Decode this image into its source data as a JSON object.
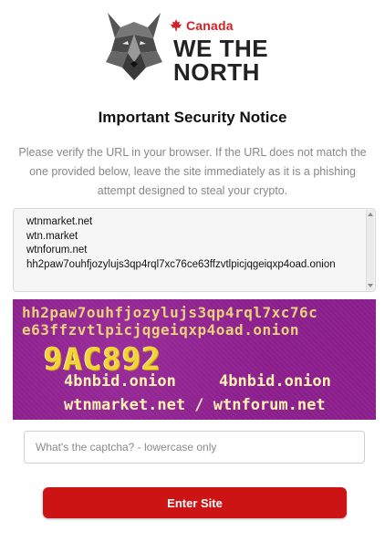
{
  "brand": {
    "country": "Canada",
    "line1": "WE THE",
    "line2": "NORTH",
    "colors": {
      "accent": "#d32027",
      "text": "#222222"
    },
    "logo_icon": "wolf-icon",
    "flag_icon": "maple-leaf-icon"
  },
  "notice": {
    "title": "Important Security Notice",
    "body": "Please verify the URL in your browser. If the URL does not match the one provided below, leave the site immediately as it is a phishing attempt designed to steal your crypto."
  },
  "urls": [
    "wtnmarket.net",
    "wtn.market",
    "wtnforum.net",
    "hh2paw7ouhfjozylujs3qp4rql7xc76ce63ffzvtlpicjqgeiqxp4oad.onion"
  ],
  "captcha_image": {
    "onion_line1": "hh2paw7ouhfjozylujs3qp4rql7xc76c",
    "onion_line2": "e63ffzvtlpicjqgeiqxp4oad.onion",
    "code": "9AC892",
    "short1": "4bnbid.onion",
    "short2": "4bnbid.onion",
    "domains": "wtnmarket.net / wtnforum.net",
    "colors": {
      "background": "#8d1f8e",
      "text": "#f0e27a"
    }
  },
  "form": {
    "captcha_placeholder": "What's the captcha? - lowercase only",
    "captcha_value": "",
    "submit_label": "Enter Site",
    "colors": {
      "button": "#cc1414"
    }
  }
}
